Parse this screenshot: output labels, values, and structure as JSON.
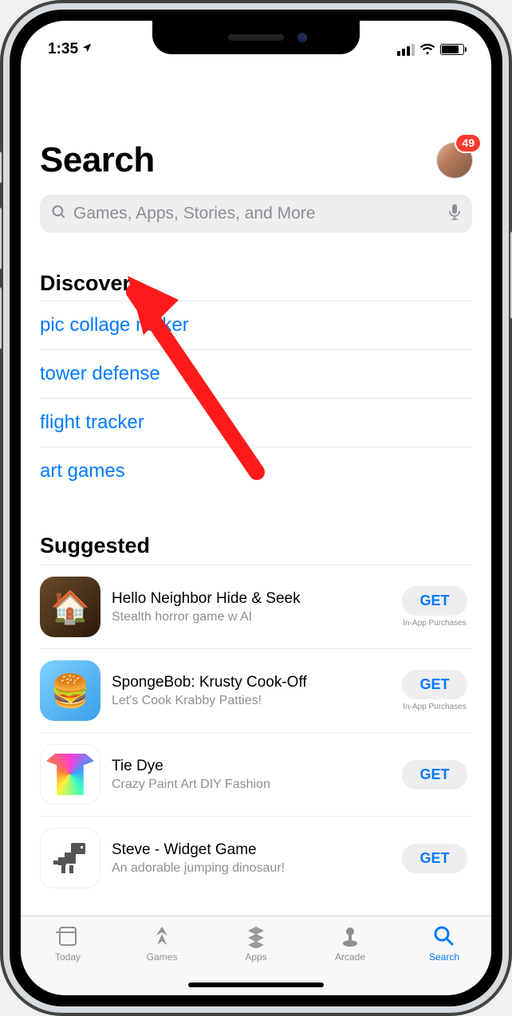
{
  "status": {
    "time": "1:35"
  },
  "header": {
    "title": "Search",
    "badge": "49"
  },
  "search": {
    "placeholder": "Games, Apps, Stories, and More"
  },
  "discover": {
    "title": "Discover",
    "items": [
      "pic collage maker",
      "tower defense",
      "flight tracker",
      "art games"
    ]
  },
  "suggested": {
    "title": "Suggested",
    "get_label": "GET",
    "iap_label": "In-App Purchases",
    "apps": [
      {
        "name": "Hello Neighbor Hide & Seek",
        "subtitle": "Stealth horror game w AI",
        "iap": true,
        "icon": "neighbor"
      },
      {
        "name": "SpongeBob: Krusty Cook-Off",
        "subtitle": "Let's Cook Krabby Patties!",
        "iap": true,
        "icon": "spongebob"
      },
      {
        "name": "Tie Dye",
        "subtitle": "Crazy Paint Art DIY Fashion",
        "iap": false,
        "icon": "tiedye"
      },
      {
        "name": "Steve - Widget Game",
        "subtitle": "An adorable jumping dinosaur!",
        "iap": false,
        "icon": "dino"
      }
    ]
  },
  "tabs": {
    "items": [
      {
        "label": "Today",
        "icon": "today"
      },
      {
        "label": "Games",
        "icon": "games"
      },
      {
        "label": "Apps",
        "icon": "apps"
      },
      {
        "label": "Arcade",
        "icon": "arcade"
      },
      {
        "label": "Search",
        "icon": "search"
      }
    ],
    "active": 4
  }
}
